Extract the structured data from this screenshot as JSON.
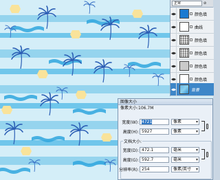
{
  "layers_panel": {
    "blend_mode": "正常",
    "opacity_mark": "⊘",
    "layers": [
      {
        "name": "颜色填",
        "thumb": "blue",
        "visible": true,
        "selected": false
      },
      {
        "name": "曲线",
        "thumb": "plain",
        "visible": true,
        "selected": false
      },
      {
        "name": "颜色填",
        "thumb": "pattern",
        "visible": true,
        "selected": false
      },
      {
        "name": "颜色填",
        "thumb": "pattern",
        "visible": true,
        "selected": false
      },
      {
        "name": "颜色填",
        "thumb": "grid",
        "visible": true,
        "selected": false
      },
      {
        "name": "颜色填",
        "thumb": "plain",
        "visible": true,
        "selected": false
      },
      {
        "name": "背景",
        "thumb": "sea",
        "visible": true,
        "selected": true
      }
    ]
  },
  "dialog": {
    "title": "图像大小",
    "pixel_size_label": "像素大小:106.7M",
    "pixel": {
      "width_label": "宽度(W):",
      "width_value": "4721",
      "width_unit": "像素",
      "height_label": "高度(H):",
      "height_value": "5927",
      "height_unit": "像素"
    },
    "doc_size": {
      "legend": "文档大小:",
      "width_label": "宽度(D):",
      "width_value": "472.1",
      "width_unit": "毫米",
      "height_label": "高度(G):",
      "height_value": "592.7",
      "height_unit": "毫米",
      "res_label": "分辨率(R):",
      "res_value": "254",
      "res_unit": "像素/英寸"
    }
  },
  "colors": {
    "sea_light": "#d4eef8",
    "sea_mid": "#8fd2ee",
    "sea_deep": "#2f9fdc",
    "sun": "#f9e39a",
    "palm": "#2c5fb5",
    "selection": "#3d86c8"
  }
}
